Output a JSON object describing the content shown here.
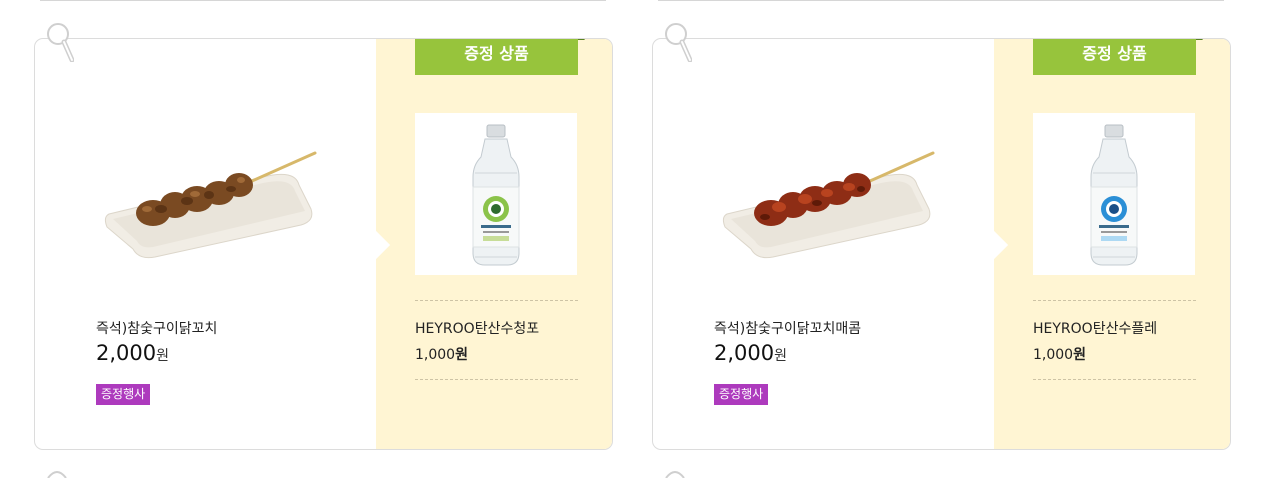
{
  "colors": {
    "ribbon_green": "#97c43c",
    "gift_panel_bg": "#fff5d3",
    "promo_purple": "#ad3abd"
  },
  "products": [
    {
      "name": "즉석)참숯구이닭꼬치",
      "price": "2,000",
      "price_unit": "원",
      "promo": "증정행사",
      "image_icon": "grilled-chicken-skewer-plate",
      "gift": {
        "ribbon_label": "증정 상품",
        "name": "HEYROO탄산수청포",
        "price": "1,000",
        "price_unit": "원",
        "image_icon": "sparkling-water-bottle-green"
      }
    },
    {
      "name": "즉석)참숯구이닭꼬치매콤",
      "price": "2,000",
      "price_unit": "원",
      "promo": "증정행사",
      "image_icon": "spicy-chicken-skewer-plate",
      "gift": {
        "ribbon_label": "증정 상품",
        "name": "HEYROO탄산수플레",
        "price": "1,000",
        "price_unit": "원",
        "image_icon": "sparkling-water-bottle-blue"
      }
    }
  ]
}
